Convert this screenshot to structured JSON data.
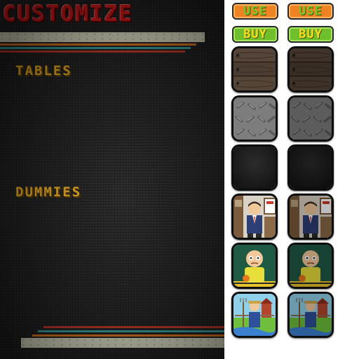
{
  "screen": {
    "title": "CUSTOMIZE",
    "sections": {
      "tables": "TABLES",
      "dummies": "DUMMIES"
    }
  },
  "buttons": {
    "use": "USE",
    "buy": "BUY"
  },
  "tiles": [
    {
      "name": "wood-table-skin"
    },
    {
      "name": "diamond-plate-table-skin"
    },
    {
      "name": "black-table-skin"
    },
    {
      "name": "office-man-dummy"
    },
    {
      "name": "bald-boy-dummy"
    },
    {
      "name": "farmer-dummy"
    }
  ],
  "colors": {
    "title": "#e01818",
    "section_label": "#f6b41f",
    "use_button": "#ef8222",
    "buy_button": "#6fbf2c",
    "panel_background": "#1c1c1c",
    "stripe_cream": "#e6e5cc",
    "stripe_orange": "#e8791e",
    "stripe_teal": "#3aa9a8",
    "stripe_red": "#c93a2a"
  }
}
